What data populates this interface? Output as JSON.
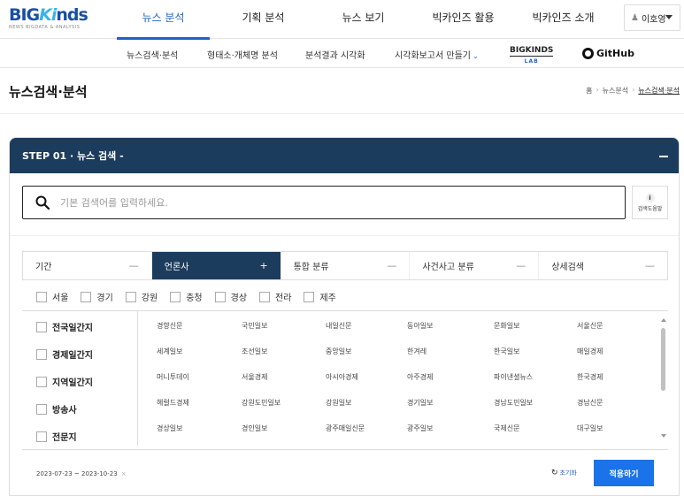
{
  "logo": {
    "big_1": "BIG",
    "big_2": "Ki",
    "big_3": "nds",
    "tagline": "NEWS BIGDATA & ANALYSIS"
  },
  "main_menu": [
    {
      "label": "뉴스 분석",
      "active": true
    },
    {
      "label": "기획 분석",
      "active": false
    },
    {
      "label": "뉴스 보기",
      "active": false
    },
    {
      "label": "빅카인즈 활용",
      "active": false
    },
    {
      "label": "빅카인즈 소개",
      "active": false
    }
  ],
  "user": {
    "name": "이호영"
  },
  "sub_menu": [
    {
      "label": "뉴스검색·분석"
    },
    {
      "label": "형태소·개체명 분석"
    },
    {
      "label": "분석결과 시각화"
    },
    {
      "label": "시각화보고서 만들기"
    }
  ],
  "sub_menu_dropdown_glyph": "⌄",
  "bigkinds_lab": {
    "top": "BIGKINDS",
    "bottom": "LAB"
  },
  "github": {
    "label": "GitHub"
  },
  "page": {
    "title": "뉴스검색·분석"
  },
  "breadcrumb": {
    "home": "홈",
    "section": "뉴스분석",
    "current": "뉴스검색·분석",
    "sep": "›"
  },
  "step": {
    "title": "STEP 01 · 뉴스 검색 -"
  },
  "search": {
    "placeholder": "기본 검색어를 입력하세요.",
    "value": ""
  },
  "help": {
    "icon": "i",
    "label": "검색도움말"
  },
  "filter_tabs": [
    {
      "label": "기간",
      "symbol": "—",
      "active": false
    },
    {
      "label": "언론사",
      "symbol": "+",
      "active": true
    },
    {
      "label": "통합 분류",
      "symbol": "—",
      "active": false
    },
    {
      "label": "사건사고 분류",
      "symbol": "—",
      "active": false
    },
    {
      "label": "상세검색",
      "symbol": "—",
      "active": false
    }
  ],
  "regions": [
    "서울",
    "경기",
    "강원",
    "충청",
    "경상",
    "전라",
    "제주"
  ],
  "categories": [
    "전국일간지",
    "경제일간지",
    "지역일간지",
    "방송사",
    "전문지"
  ],
  "media_rows": [
    [
      "경향신문",
      "국민일보",
      "내일신문",
      "동아일보",
      "문화일보",
      "서울신문"
    ],
    [
      "세계일보",
      "조선일보",
      "중앙일보",
      "한겨레",
      "한국일보",
      "매일경제"
    ],
    [
      "머니투데이",
      "서울경제",
      "아시아경제",
      "아주경제",
      "파이낸셜뉴스",
      "한국경제"
    ],
    [
      "헤럴드경제",
      "강원도민일보",
      "강원일보",
      "경기일보",
      "경남도민일보",
      "경남신문"
    ],
    [
      "경상일보",
      "경인일보",
      "광주매일신문",
      "광주일보",
      "국제신문",
      "대구일보"
    ]
  ],
  "footer": {
    "date_range": "2023-07-23 ~ 2023-10-23",
    "date_clear": "×",
    "reset_label": "초기화",
    "apply_label": "적용하기"
  },
  "colors": {
    "brand_blue": "#1e62c9",
    "panel_navy": "#1c3c5d",
    "apply_blue": "#1a73e8"
  }
}
